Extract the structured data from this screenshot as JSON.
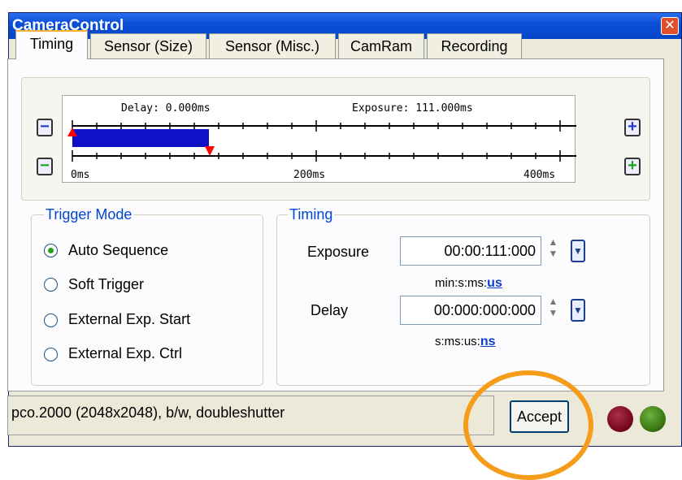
{
  "window": {
    "title": "CameraControl",
    "close_glyph": "✕"
  },
  "tabs": [
    "Timing",
    "Sensor (Size)",
    "Sensor (Misc.)",
    "CamRam",
    "Recording"
  ],
  "active_tab": "Timing",
  "timeline": {
    "delay_label": "Delay: 0.000ms",
    "exposure_label": "Exposure: 111.000ms",
    "axis_labels": [
      "0ms",
      "200ms",
      "400ms"
    ],
    "bar_color": "#1010c8",
    "marker_color": "#ff0000"
  },
  "zoom_buttons": {
    "minus_blue": "minus-icon",
    "minus_green": "minus-icon",
    "plus_blue": "plus-icon",
    "plus_green": "plus-icon",
    "minus_glyph": "−",
    "plus_glyph": "+"
  },
  "trigger_mode": {
    "legend": "Trigger Mode",
    "options": [
      "Auto Sequence",
      "Soft Trigger",
      "External Exp. Start",
      "External Exp. Ctrl"
    ],
    "selected": "Auto Sequence"
  },
  "timing": {
    "legend": "Timing",
    "exposure": {
      "label": "Exposure",
      "value": "00:00:111:000",
      "unit_prefix": "min:s:ms:",
      "unit_active": "us"
    },
    "delay": {
      "label": "Delay",
      "value": "00:000:000:000",
      "unit_prefix": "s:ms:us:",
      "unit_active": "ns"
    },
    "spin_up": "▲",
    "spin_down": "▼",
    "dropdown_glyph": "▼"
  },
  "status": {
    "text": "pco.2000 (2048x2048), b/w,  doubleshutter"
  },
  "accept_label": "Accept",
  "colors": {
    "led_red": "#7a0a1e",
    "led_green": "#3c7a14",
    "highlight_circle": "#f59c1a",
    "title_bar": "#0a4fd6"
  }
}
